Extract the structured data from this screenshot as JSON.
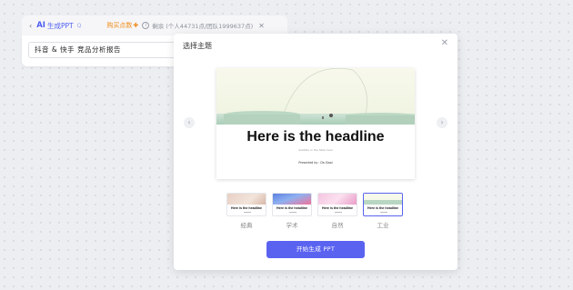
{
  "ai_bar": {
    "back_icon": "chevron-left-icon",
    "ai_label": "AI",
    "generate_label": "生成PPT",
    "q_icon": "Q",
    "buy_label": "购买点数",
    "buy_plus_icon": "✚",
    "remaining_text": "剩余 (个人44731点/团队1999637点)",
    "close_icon": "close-icon"
  },
  "prompt": {
    "value": "抖音 & 快手 竞品分析报告"
  },
  "modal": {
    "title": "选择主题",
    "close_icon": "close-icon",
    "prev_icon": "chevron-left-icon",
    "next_icon": "chevron-right-icon",
    "preview": {
      "headline": "Here is the headline",
      "subtitle": "Subtitle or the Slide here",
      "presented_by": "Presented by : Da Xiaoi"
    },
    "themes": [
      {
        "label": "经典",
        "thumb_text": "Here is the headline",
        "selected": false
      },
      {
        "label": "学术",
        "thumb_text": "Here is the headline",
        "selected": false
      },
      {
        "label": "自然",
        "thumb_text": "Here is the headline",
        "selected": false
      },
      {
        "label": "工业",
        "thumb_text": "Here is the headline",
        "selected": true
      }
    ],
    "generate_button": "开始生成 PPT"
  },
  "colors": {
    "accent": "#5a63f0",
    "ai_blue": "#4d5df5",
    "buy_orange": "#f08c1a"
  }
}
